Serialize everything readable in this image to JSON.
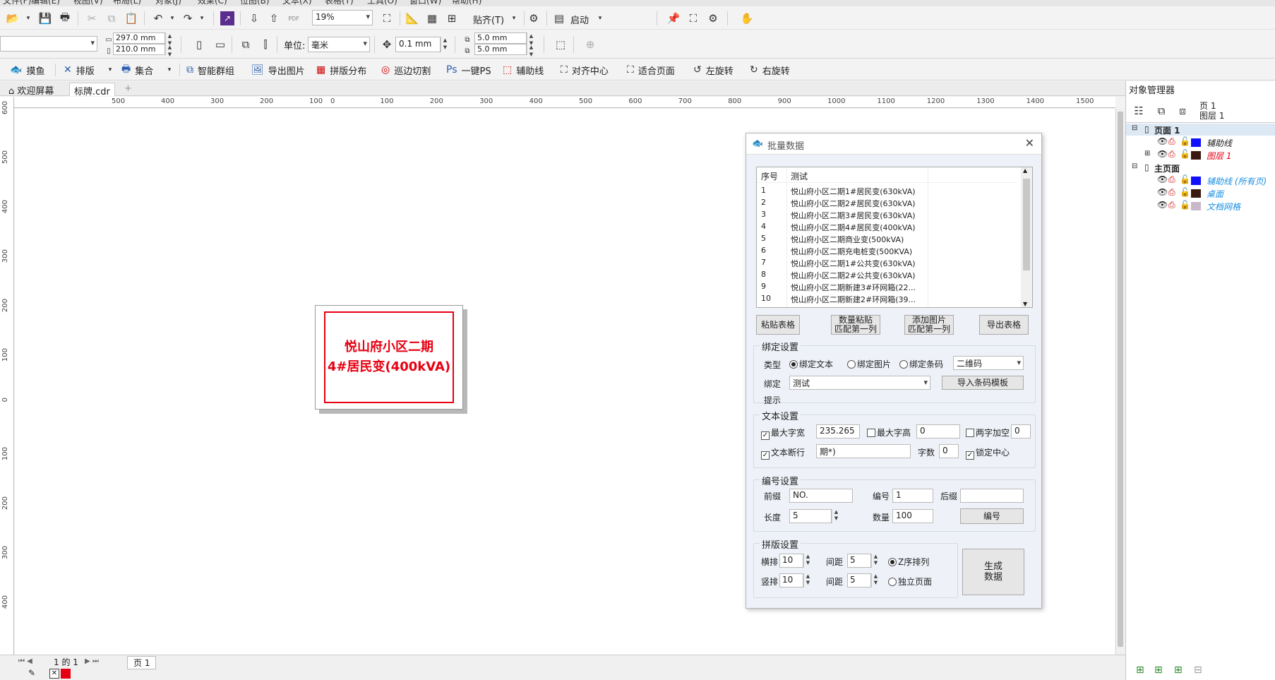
{
  "menubar": {
    "items": [
      "文件(F)",
      "编辑(E)",
      "视图(V)",
      "布局(L)",
      "对象(J)",
      "效果(C)",
      "位图(B)",
      "文本(X)",
      "表格(T)",
      "工具(O)",
      "窗口(W)",
      "帮助(H)"
    ]
  },
  "toolbar1": {
    "zoom": "19%",
    "snap_label": "贴齐(T)",
    "launch_label": "启动",
    "pdf_label": "PDF"
  },
  "toolbar2": {
    "width": "297.0 mm",
    "height": "210.0 mm",
    "unit_label": "单位:",
    "unit_value": "毫米",
    "nudge": "0.1 mm",
    "dup_x": "5.0 mm",
    "dup_y": "5.0 mm"
  },
  "toolbar3": {
    "items": [
      "摸鱼",
      "排版",
      "集合",
      "智能群组",
      "导出图片",
      "拼版分布",
      "巡边切割",
      "一键PS",
      "辅助线",
      "对齐中心",
      "适合页面",
      "左旋转",
      "右旋转"
    ]
  },
  "tabs": {
    "welcome": "欢迎屏幕",
    "doc": "标牌.cdr"
  },
  "ruler": {
    "h_ticks": [
      "500",
      "400",
      "300",
      "200",
      "100",
      "0",
      "100",
      "200",
      "300",
      "400",
      "500",
      "600",
      "700",
      "800",
      "900",
      "1000",
      "1100",
      "1200",
      "1300",
      "1400",
      "1500"
    ],
    "v_ticks": [
      "600",
      "500",
      "400",
      "300",
      "200",
      "100",
      "0",
      "100",
      "200",
      "300",
      "400"
    ]
  },
  "plate": {
    "line1": "悦山府小区二期",
    "line2": "4#居民变(400kVA)"
  },
  "status": {
    "page_of": "1 的 1",
    "page_tab": "页 1"
  },
  "objmgr": {
    "title": "对象管理器",
    "header_page": "页 1",
    "header_layer": "图层 1",
    "tree": [
      {
        "label": "页面 1",
        "bold": true
      },
      {
        "label": "辅助线",
        "color": "#1010ff",
        "style": "italic"
      },
      {
        "label": "图层 1",
        "color": "#3a1a10",
        "style": "red"
      },
      {
        "label": "主页面",
        "bold": true
      },
      {
        "label": "辅助线 (所有页)",
        "color": "#1010ff",
        "style": "blue"
      },
      {
        "label": "桌面",
        "color": "#3a1a10",
        "style": "blue"
      },
      {
        "label": "文档网格",
        "color": "#c9b8c9",
        "style": "blue"
      }
    ]
  },
  "dialog": {
    "title": "批量数据",
    "table": {
      "headers": [
        "序号",
        "测试"
      ],
      "rows": [
        [
          "1",
          "悦山府小区二期1#居民变(630kVA)"
        ],
        [
          "2",
          "悦山府小区二期2#居民变(630kVA)"
        ],
        [
          "3",
          "悦山府小区二期3#居民变(630kVA)"
        ],
        [
          "4",
          "悦山府小区二期4#居民变(400kVA)"
        ],
        [
          "5",
          "悦山府小区二期商业变(500kVA)"
        ],
        [
          "6",
          "悦山府小区二期充电桩变(500KVA)"
        ],
        [
          "7",
          "悦山府小区二期1#公共变(630kVA)"
        ],
        [
          "8",
          "悦山府小区二期2#公共变(630kVA)"
        ],
        [
          "9",
          "悦山府小区二期新建3#环网箱(22..."
        ],
        [
          "10",
          "悦山府小区二期新建2#环网箱(39..."
        ]
      ]
    },
    "buttons": {
      "paste": "粘贴表格",
      "count_paste": "数量粘贴\n匹配第一列",
      "add_image": "添加图片\n匹配第一列",
      "export": "导出表格"
    },
    "bind": {
      "title": "绑定设置",
      "type_label": "类型",
      "opt_text": "绑定文本",
      "opt_image": "绑定图片",
      "opt_barcode": "绑定条码",
      "barcode_type": "二维码",
      "bind_label": "绑定",
      "bind_value": "测试",
      "import_btn": "导入条码模板",
      "hint_label": "提示"
    },
    "text": {
      "title": "文本设置",
      "max_width_label": "最大字宽",
      "max_width": "235.265",
      "max_height_label": "最大字高",
      "max_height": "0",
      "two_char_label": "两字加空",
      "two_char": "0",
      "break_label": "文本断行",
      "break_value": "期*)",
      "count_label": "字数",
      "count_value": "0",
      "lock_center_label": "锁定中心"
    },
    "number": {
      "title": "编号设置",
      "prefix_label": "前缀",
      "prefix": "NO.",
      "num_label": "编号",
      "num": "1",
      "suffix_label": "后缀",
      "suffix": "",
      "length_label": "长度",
      "length": "5",
      "qty_label": "数量",
      "qty": "100",
      "btn": "编号"
    },
    "imposition": {
      "title": "拼版设置",
      "cols_label": "横排",
      "cols": "10",
      "rows_label": "竖排",
      "rows": "10",
      "gap_label": "间距",
      "gap_h": "5",
      "gap_v": "5",
      "z_order": "Z序排列",
      "indep": "独立页面",
      "generate": "生成\n数据"
    }
  }
}
